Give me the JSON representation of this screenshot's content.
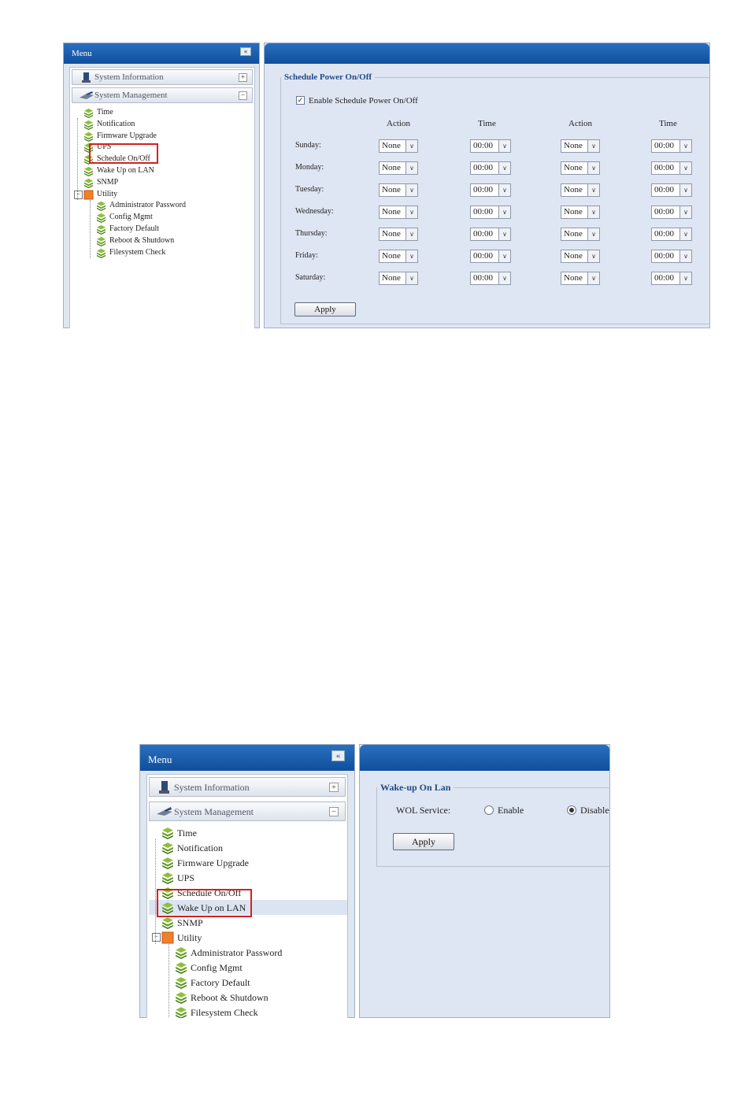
{
  "screenshot1": {
    "menu": {
      "title": "Menu",
      "collapse_icon": "«",
      "system_information": {
        "label": "System Information",
        "toggle": "+"
      },
      "system_management": {
        "label": "System Management",
        "toggle": "−"
      },
      "items": [
        "Time",
        "Notification",
        "Firmware Upgrade",
        "UPS",
        "Schedule On/Off",
        "Wake Up on LAN",
        "SNMP"
      ],
      "utility": {
        "label": "Utility",
        "toggle": "−",
        "children": [
          "Administrator Password",
          "Config Mgmt",
          "Factory Default",
          "Reboot & Shutdown",
          "Filesystem Check"
        ]
      },
      "selected": "Schedule On/Off"
    },
    "schedule": {
      "legend": "Schedule Power On/Off",
      "enable_label": "Enable Schedule Power On/Off",
      "enable_checked": "✓",
      "headers": [
        "Action",
        "Time",
        "Action",
        "Time"
      ],
      "rows": [
        {
          "day": "Sunday:",
          "action1": "None",
          "time1": "00:00",
          "action2": "None",
          "time2": "00:00"
        },
        {
          "day": "Monday:",
          "action1": "None",
          "time1": "00:00",
          "action2": "None",
          "time2": "00:00"
        },
        {
          "day": "Tuesday:",
          "action1": "None",
          "time1": "00:00",
          "action2": "None",
          "time2": "00:00"
        },
        {
          "day": "Wednesday:",
          "action1": "None",
          "time1": "00:00",
          "action2": "None",
          "time2": "00:00"
        },
        {
          "day": "Thursday:",
          "action1": "None",
          "time1": "00:00",
          "action2": "None",
          "time2": "00:00"
        },
        {
          "day": "Friday:",
          "action1": "None",
          "time1": "00:00",
          "action2": "None",
          "time2": "00:00"
        },
        {
          "day": "Saturday:",
          "action1": "None",
          "time1": "00:00",
          "action2": "None",
          "time2": "00:00"
        }
      ],
      "apply_label": "Apply"
    }
  },
  "screenshot2": {
    "menu": {
      "title": "Menu",
      "collapse_icon": "«",
      "system_information": {
        "label": "System Information",
        "toggle": "+"
      },
      "system_management": {
        "label": "System Management",
        "toggle": "−"
      },
      "items": [
        "Time",
        "Notification",
        "Firmware Upgrade",
        "UPS",
        "Schedule On/Off",
        "Wake Up on LAN",
        "SNMP"
      ],
      "utility": {
        "label": "Utility",
        "toggle": "−",
        "children": [
          "Administrator Password",
          "Config Mgmt",
          "Factory Default",
          "Reboot & Shutdown",
          "Filesystem Check"
        ]
      },
      "selected": "Wake Up on LAN"
    },
    "wol": {
      "legend": "Wake-up On Lan",
      "service_label": "WOL Service:",
      "enable_label": "Enable",
      "disable_label": "Disable",
      "selected_option": "Disable",
      "apply_label": "Apply"
    }
  },
  "colors": {
    "title_bar": "#1560b0",
    "panel_bg": "#dfe6f3",
    "highlight_box": "#d62020",
    "legend_text": "#1f4a85"
  }
}
